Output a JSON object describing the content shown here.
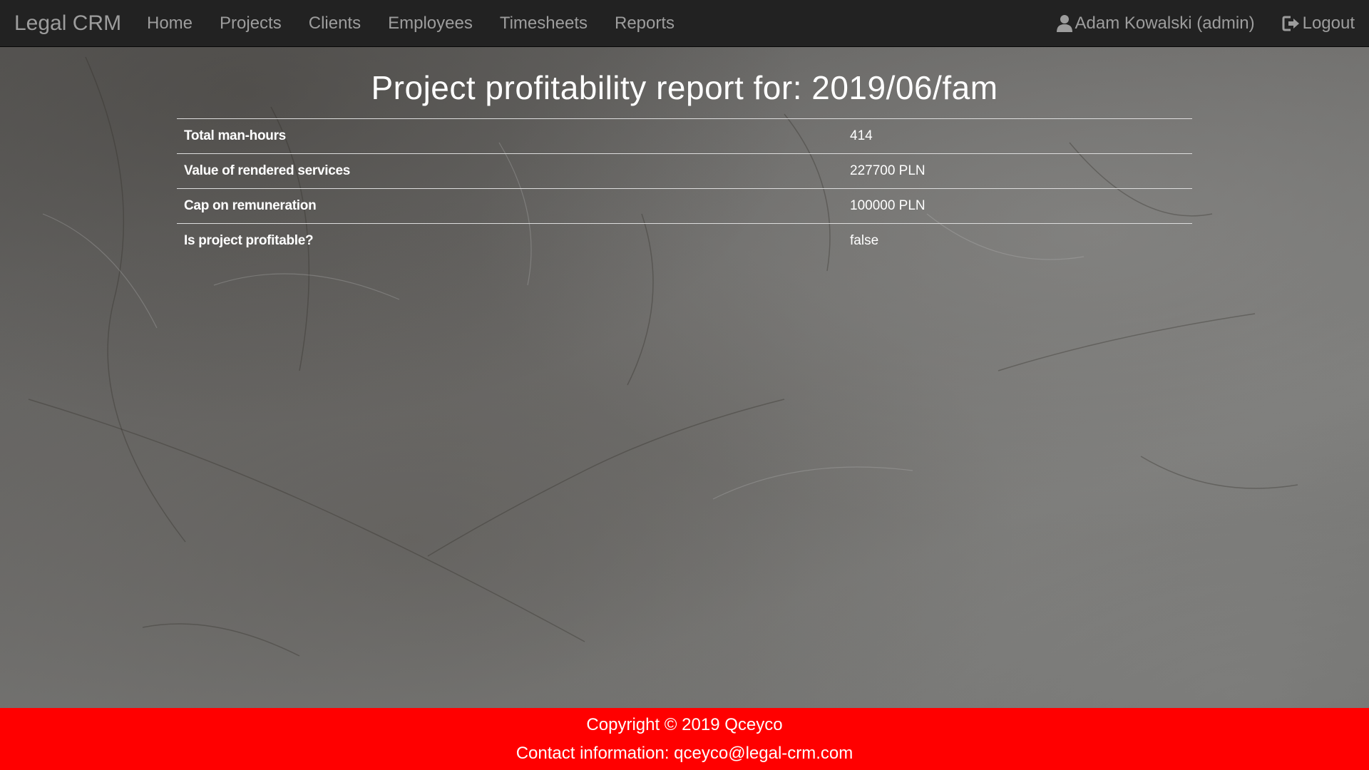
{
  "navbar": {
    "brand": "Legal CRM",
    "links": [
      {
        "label": "Home"
      },
      {
        "label": "Projects"
      },
      {
        "label": "Clients"
      },
      {
        "label": "Employees"
      },
      {
        "label": "Timesheets"
      },
      {
        "label": "Reports"
      }
    ],
    "user": {
      "label": "Adam Kowalski (admin)",
      "icon": "user-icon"
    },
    "logout": {
      "label": "Logout",
      "icon": "logout-icon"
    }
  },
  "report": {
    "title": "Project profitability report for: 2019/06/fam",
    "rows": [
      {
        "label": "Total man-hours",
        "value": "414"
      },
      {
        "label": "Value of rendered services",
        "value": "227700 PLN"
      },
      {
        "label": "Cap on remuneration",
        "value": "100000 PLN"
      },
      {
        "label": "Is project profitable?",
        "value": "false"
      }
    ]
  },
  "footer": {
    "copyright": "Copyright © 2019 Qceyco",
    "contact": "Contact information: qceyco@legal-crm.com"
  },
  "colors": {
    "navbar_bg": "#222222",
    "nav_text": "#9d9d9d",
    "footer_bg": "#ff0000",
    "text": "#ffffff"
  }
}
